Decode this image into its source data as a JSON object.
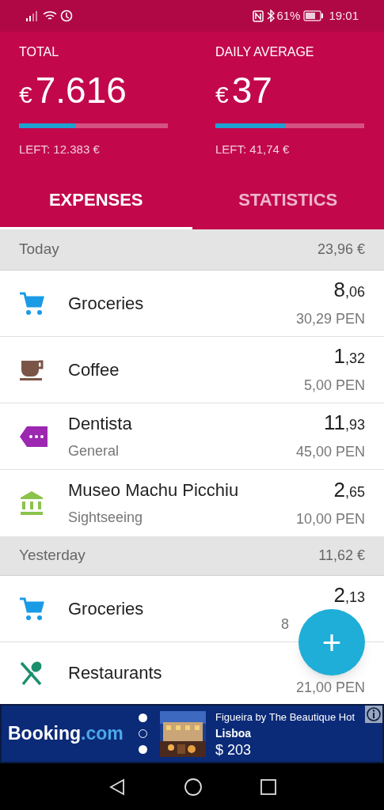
{
  "status_bar": {
    "battery": "61%",
    "time": "19:01"
  },
  "summary": [
    {
      "label": "TOTAL",
      "currency": "€",
      "value": "7.616",
      "level": 0.38,
      "left": "LEFT: 12.383 €"
    },
    {
      "label": "DAILY AVERAGE",
      "currency": "€",
      "value": "37",
      "level": 0.47,
      "left": "LEFT: 41,74 €"
    }
  ],
  "tabs": [
    {
      "label": "EXPENSES",
      "selected": true
    },
    {
      "label": "STATISTICS",
      "selected": false
    }
  ],
  "days": [
    {
      "title": "Today",
      "total": "23,96 €",
      "items": [
        {
          "kind": "groceries",
          "name": "Groceries",
          "major": "8",
          "minor": ",06",
          "converted": "30,29 PEN"
        },
        {
          "kind": "coffee",
          "name": "Coffee",
          "major": "1",
          "minor": ",32",
          "converted": "5,00 PEN"
        },
        {
          "kind": "general",
          "name": "Dentista",
          "note": "General",
          "major": "11",
          "minor": ",93",
          "converted": "45,00 PEN"
        },
        {
          "kind": "sightseeing",
          "name": "Museo Machu Picchiu",
          "note": "Sightseeing",
          "major": "2",
          "minor": ",65",
          "converted": "10,00 PEN"
        }
      ]
    },
    {
      "title": "Yesterday",
      "total": "11,62 €",
      "items": [
        {
          "kind": "groceries",
          "name": "Groceries",
          "major": "2",
          "minor": ",13",
          "converted": "8"
        },
        {
          "kind": "restaurants",
          "name": "Restaurants",
          "converted": "21,00 PEN"
        }
      ]
    }
  ],
  "fab": {
    "label": "+"
  },
  "ad": {
    "brand": "Booking",
    "brand_suffix": ".com",
    "dots": [
      {
        "filled": true
      },
      {
        "filled": false
      },
      {
        "filled": true
      }
    ],
    "hotel": "Figueira by The Beautique Hot",
    "city": "Lisboa",
    "price": "$ 203"
  }
}
